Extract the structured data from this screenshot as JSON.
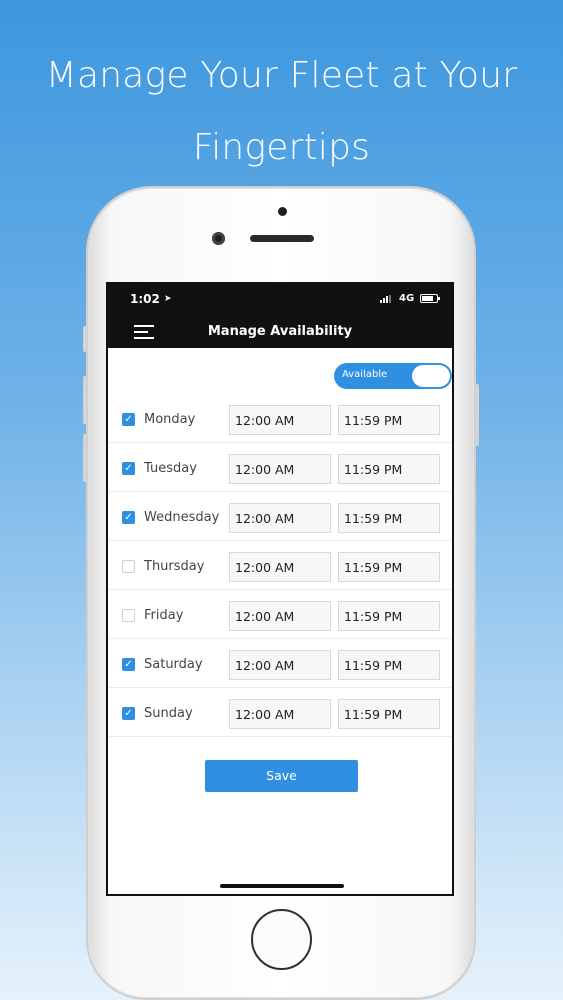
{
  "headline": {
    "line1": "Manage Your Fleet at Your",
    "line2": "Fingertips"
  },
  "status_bar": {
    "time": "1:02",
    "network": "4G",
    "location_icon": "location-arrow-icon",
    "signal_icon": "signal-bars-icon",
    "battery_icon": "battery-icon"
  },
  "nav": {
    "title": "Manage Availability",
    "menu_icon": "hamburger-menu-icon"
  },
  "availability_toggle": {
    "label": "Available",
    "on": true
  },
  "days": [
    {
      "name": "Monday",
      "checked": true,
      "start": "12:00 AM",
      "end": "11:59 PM"
    },
    {
      "name": "Tuesday",
      "checked": true,
      "start": "12:00 AM",
      "end": "11:59 PM"
    },
    {
      "name": "Wednesday",
      "checked": true,
      "start": "12:00 AM",
      "end": "11:59 PM"
    },
    {
      "name": "Thursday",
      "checked": false,
      "start": "12:00 AM",
      "end": "11:59 PM"
    },
    {
      "name": "Friday",
      "checked": false,
      "start": "12:00 AM",
      "end": "11:59 PM"
    },
    {
      "name": "Saturday",
      "checked": true,
      "start": "12:00 AM",
      "end": "11:59 PM"
    },
    {
      "name": "Sunday",
      "checked": true,
      "start": "12:00 AM",
      "end": "11:59 PM"
    }
  ],
  "save_label": "Save",
  "colors": {
    "accent": "#2f8fe0",
    "nav_background": "#111111",
    "background_top": "#3d97de",
    "background_bottom": "#e6f2fb"
  }
}
